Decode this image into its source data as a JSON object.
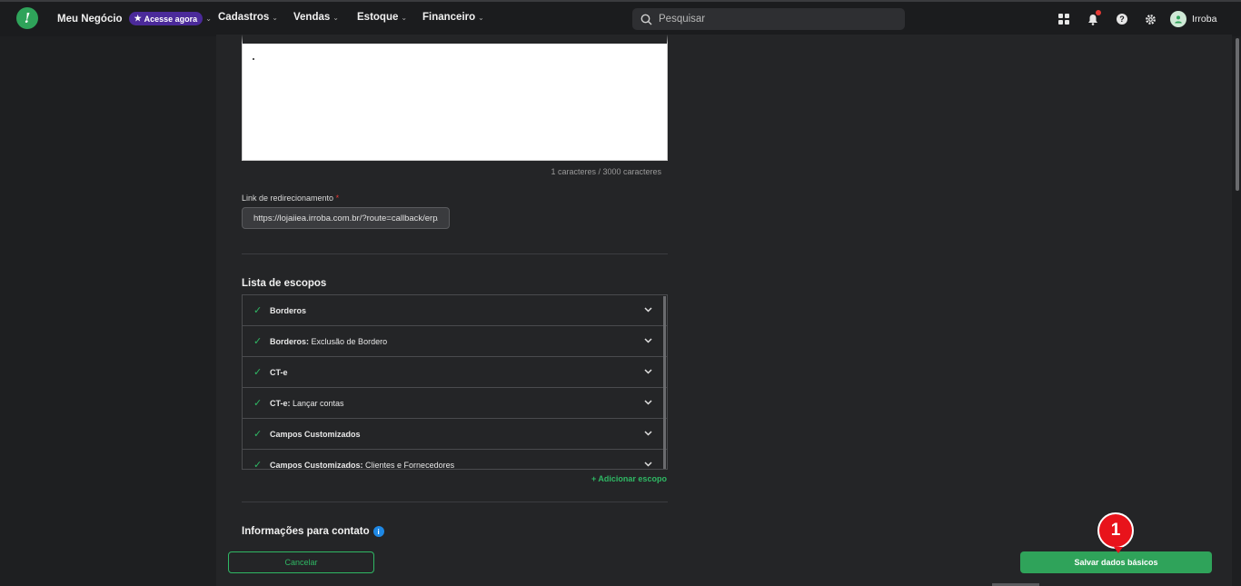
{
  "navbar": {
    "logo_glyph": "!",
    "items": [
      {
        "label": "Meu Negócio"
      },
      {
        "label": "Cadastros"
      },
      {
        "label": "Vendas"
      },
      {
        "label": "Estoque"
      },
      {
        "label": "Financeiro"
      }
    ],
    "access_badge": "Acesse agora",
    "search_placeholder": "Pesquisar",
    "user_name": "Irroba",
    "icons": [
      "apps-icon",
      "bell-icon",
      "help-icon",
      "gear-icon",
      "user-icon"
    ]
  },
  "form": {
    "description_char_count": "1 caracteres / 3000 caracteres",
    "redirect_label": "Link de redirecionamento",
    "required_mark": "*",
    "redirect_value": "https://lojaiiea.irroba.com.br/?route=callback/erp/",
    "scopes_title": "Lista de escopos",
    "scopes": [
      {
        "name": "Borderos",
        "detail": ""
      },
      {
        "name": "Borderos:",
        "detail": "Exclusão de Bordero"
      },
      {
        "name": "CT-e",
        "detail": ""
      },
      {
        "name": "CT-e:",
        "detail": "Lançar contas"
      },
      {
        "name": "Campos Customizados",
        "detail": ""
      },
      {
        "name": "Campos Customizados:",
        "detail": "Clientes e Fornecedores"
      }
    ],
    "add_scope_label": "+ Adicionar escopo",
    "contact_title": "Informações para contato",
    "info_glyph": "i"
  },
  "footer": {
    "cancel_label": "Cancelar",
    "save_label": "Salvar dados básicos"
  },
  "annotation": {
    "step_number": "1"
  },
  "colors": {
    "brand_green": "#2fa35a",
    "accent_green": "#2fb864",
    "badge_purple": "#4b2a9a",
    "marker_red": "#e8131b"
  }
}
